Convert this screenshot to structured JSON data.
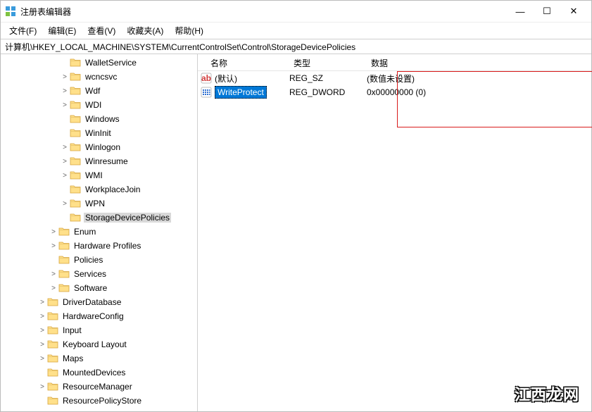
{
  "title": "注册表编辑器",
  "win_controls": {
    "min": "—",
    "max": "☐",
    "close": "✕"
  },
  "menu": [
    "文件(F)",
    "编辑(E)",
    "查看(V)",
    "收藏夹(A)",
    "帮助(H)"
  ],
  "address": "计算机\\HKEY_LOCAL_MACHINE\\SYSTEM\\CurrentControlSet\\Control\\StorageDevicePolicies",
  "columns": {
    "name": "名称",
    "type": "类型",
    "data": "数据"
  },
  "tree": [
    {
      "depth": 5,
      "label": "WalletService",
      "expander": ""
    },
    {
      "depth": 5,
      "label": "wcncsvc",
      "expander": ">"
    },
    {
      "depth": 5,
      "label": "Wdf",
      "expander": ">"
    },
    {
      "depth": 5,
      "label": "WDI",
      "expander": ">"
    },
    {
      "depth": 5,
      "label": "Windows",
      "expander": ""
    },
    {
      "depth": 5,
      "label": "WinInit",
      "expander": ""
    },
    {
      "depth": 5,
      "label": "Winlogon",
      "expander": ">"
    },
    {
      "depth": 5,
      "label": "Winresume",
      "expander": ">"
    },
    {
      "depth": 5,
      "label": "WMI",
      "expander": ">"
    },
    {
      "depth": 5,
      "label": "WorkplaceJoin",
      "expander": ""
    },
    {
      "depth": 5,
      "label": "WPN",
      "expander": ">"
    },
    {
      "depth": 5,
      "label": "StorageDevicePolicies",
      "expander": "",
      "selected": true
    },
    {
      "depth": 4,
      "label": "Enum",
      "expander": ">"
    },
    {
      "depth": 4,
      "label": "Hardware Profiles",
      "expander": ">"
    },
    {
      "depth": 4,
      "label": "Policies",
      "expander": ""
    },
    {
      "depth": 4,
      "label": "Services",
      "expander": ">"
    },
    {
      "depth": 4,
      "label": "Software",
      "expander": ">"
    },
    {
      "depth": 3,
      "label": "DriverDatabase",
      "expander": ">"
    },
    {
      "depth": 3,
      "label": "HardwareConfig",
      "expander": ">"
    },
    {
      "depth": 3,
      "label": "Input",
      "expander": ">"
    },
    {
      "depth": 3,
      "label": "Keyboard Layout",
      "expander": ">"
    },
    {
      "depth": 3,
      "label": "Maps",
      "expander": ">"
    },
    {
      "depth": 3,
      "label": "MountedDevices",
      "expander": ""
    },
    {
      "depth": 3,
      "label": "ResourceManager",
      "expander": ">"
    },
    {
      "depth": 3,
      "label": "ResourcePolicyStore",
      "expander": ""
    }
  ],
  "values": [
    {
      "icon": "sz",
      "name": "(默认)",
      "type": "REG_SZ",
      "data": "(数值未设置)",
      "selected": false
    },
    {
      "icon": "dword",
      "name": "WriteProtect",
      "type": "REG_DWORD",
      "data": "0x00000000 (0)",
      "selected": true
    }
  ],
  "watermark": "江西龙网"
}
